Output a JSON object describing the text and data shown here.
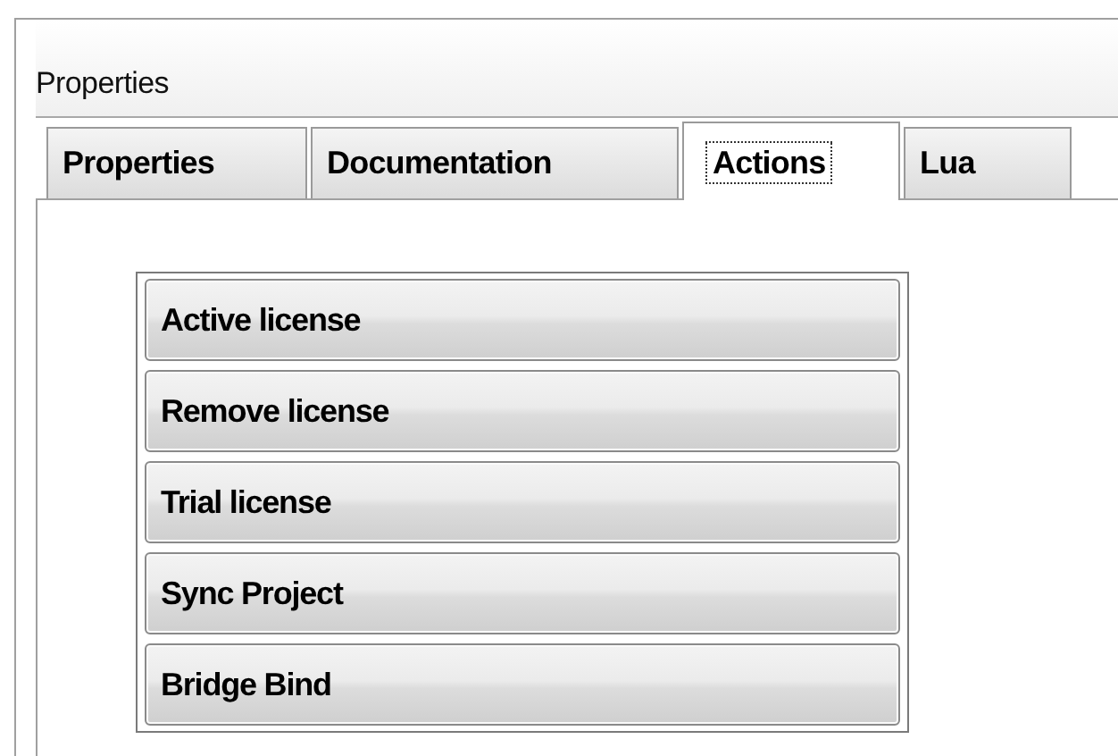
{
  "panel": {
    "title": "Properties"
  },
  "tabs": [
    {
      "label": "Properties",
      "selected": false
    },
    {
      "label": "Documentation",
      "selected": false
    },
    {
      "label": "Actions",
      "selected": true
    },
    {
      "label": "Lua",
      "selected": false
    }
  ],
  "actions": [
    "Active license",
    "Remove license",
    "Trial license",
    "Sync Project",
    "Bridge Bind"
  ]
}
